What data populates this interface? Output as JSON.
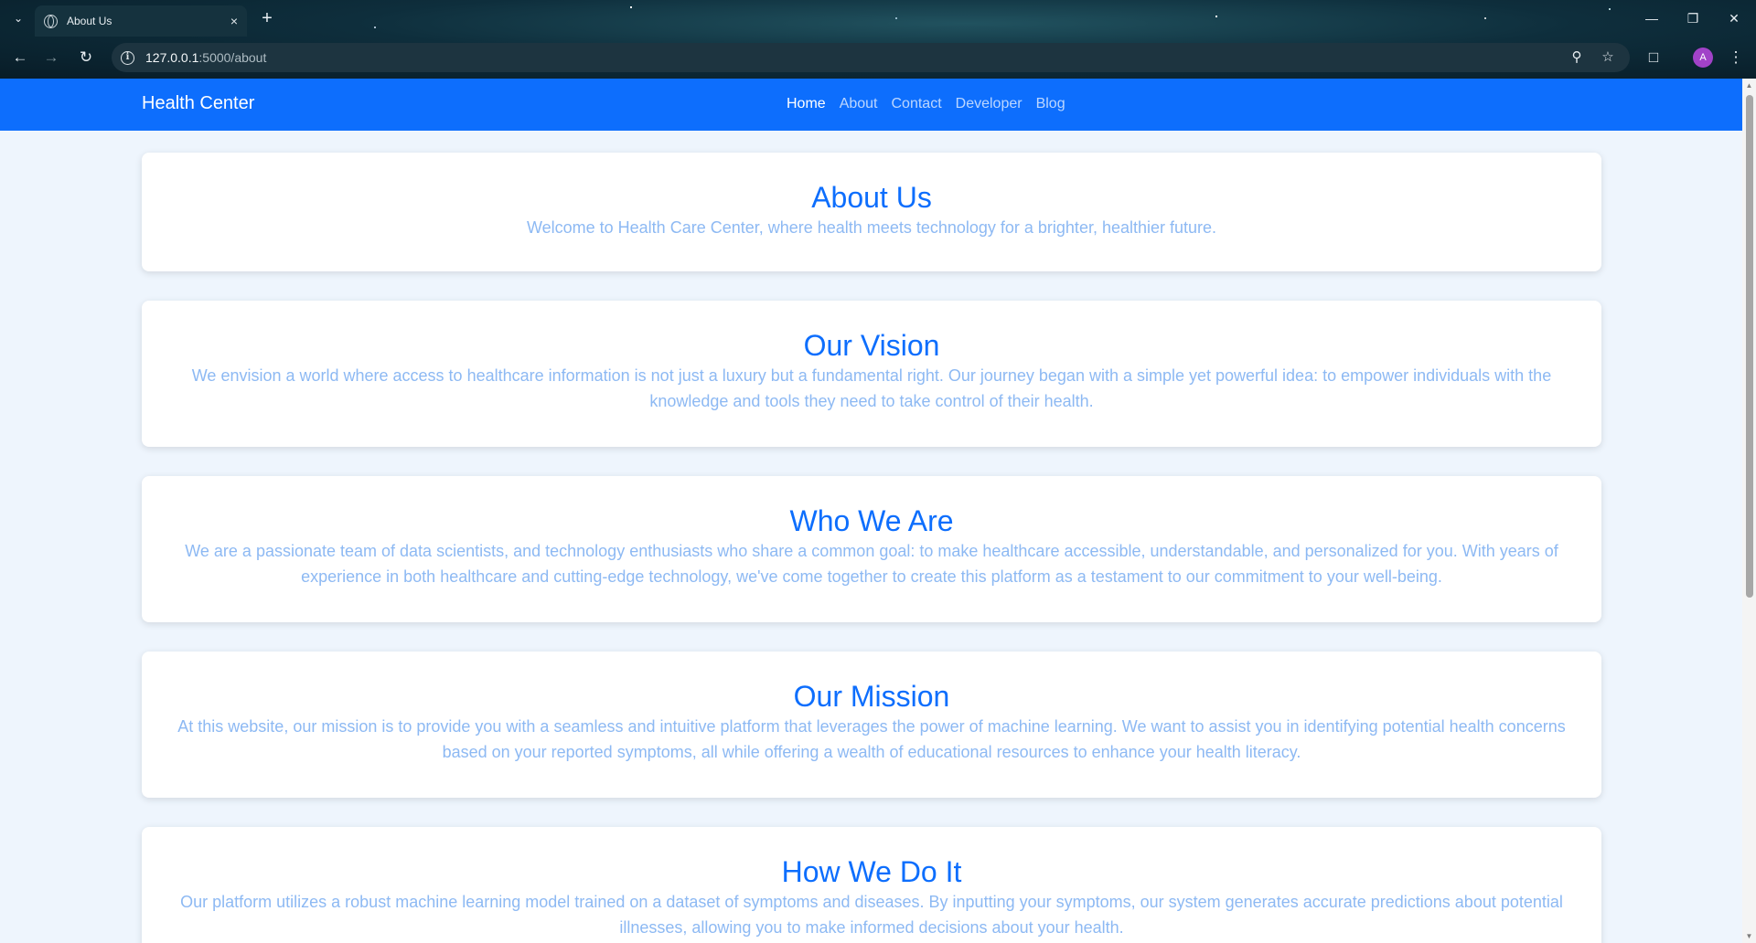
{
  "browser": {
    "tab_title": "About Us",
    "tab_close": "×",
    "new_tab": "+",
    "url_host": "127.0.0.1",
    "url_path": ":5000/about",
    "profile_initial": "A",
    "icons": [
      "tab-list-icon",
      "globe-icon",
      "close-icon",
      "plus-icon",
      "minimize-icon",
      "restore-icon",
      "window-close-icon",
      "back-icon",
      "forward-icon",
      "reload-icon",
      "info-icon",
      "zoom-icon",
      "star-icon",
      "extensions-icon",
      "menu-icon"
    ]
  },
  "navbar": {
    "brand": "Health Center",
    "links": [
      "Home",
      "About",
      "Contact",
      "Developer",
      "Blog"
    ],
    "active": "Home",
    "color": "#0d6efd"
  },
  "sections": [
    {
      "title": "About Us",
      "text": "Welcome to Health Care Center, where health meets technology for a brighter, healthier future."
    },
    {
      "title": "Our Vision",
      "text": "We envision a world where access to healthcare information is not just a luxury but a fundamental right. Our journey began with a simple yet powerful idea: to empower individuals with the knowledge and tools they need to take control of their health."
    },
    {
      "title": "Who We Are",
      "text": "We are a passionate team of data scientists, and technology enthusiasts who share a common goal: to make healthcare accessible, understandable, and personalized for you. With years of experience in both healthcare and cutting-edge technology, we've come together to create this platform as a testament to our commitment to your well-being."
    },
    {
      "title": "Our Mission",
      "text": "At this website, our mission is to provide you with a seamless and intuitive platform that leverages the power of machine learning. We want to assist you in identifying potential health concerns based on your reported symptoms, all while offering a wealth of educational resources to enhance your health literacy."
    },
    {
      "title": "How We Do It",
      "text": "Our platform utilizes a robust machine learning model trained on a dataset of symptoms and diseases. By inputting your symptoms, our system generates accurate predictions about potential illnesses, allowing you to make informed decisions about your health."
    }
  ]
}
